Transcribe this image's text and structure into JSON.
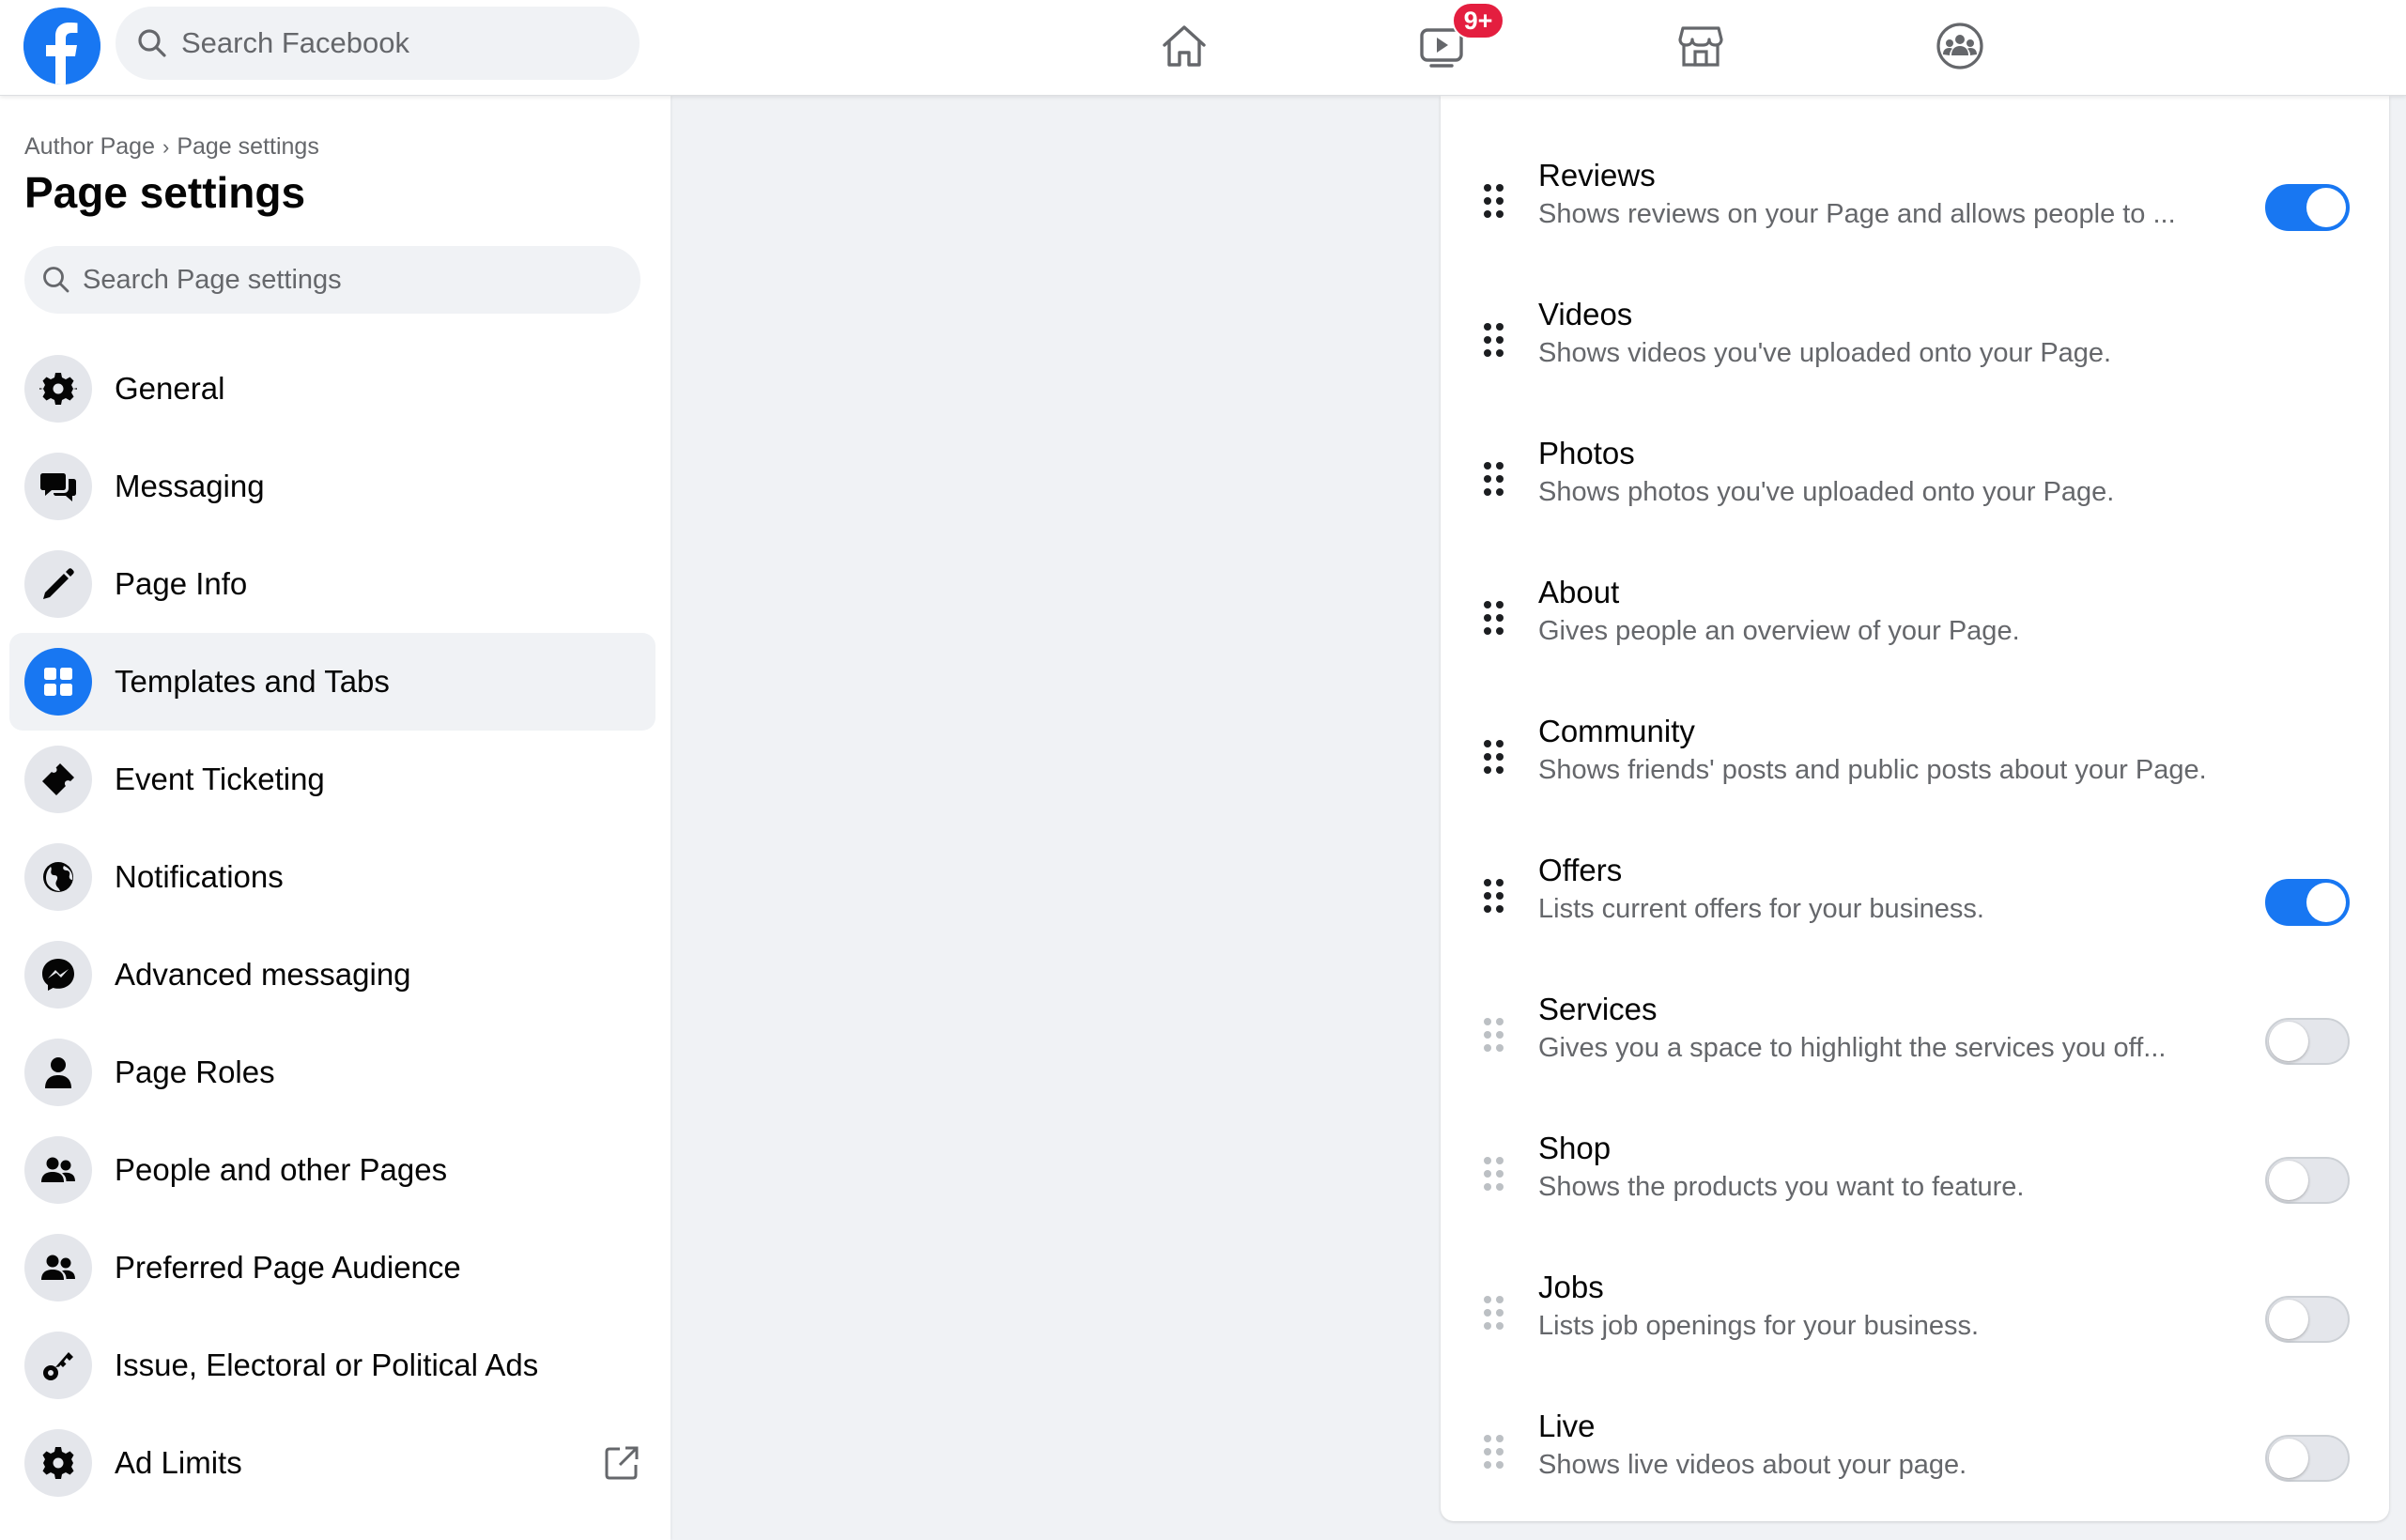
{
  "header": {
    "search_placeholder": "Search Facebook",
    "watch_badge": "9+",
    "brand_color": "#1877f2",
    "nav_icons": [
      "home-icon",
      "watch-icon",
      "marketplace-icon",
      "groups-icon"
    ]
  },
  "sidebar": {
    "breadcrumb": [
      "Author Page",
      "Page settings"
    ],
    "title": "Page settings",
    "search_placeholder": "Search Page settings",
    "items": [
      {
        "label": "General",
        "icon": "gear-icon",
        "active": false
      },
      {
        "label": "Messaging",
        "icon": "chat-bubbles-icon",
        "active": false
      },
      {
        "label": "Page Info",
        "icon": "pencil-icon",
        "active": false
      },
      {
        "label": "Templates and Tabs",
        "icon": "grid-icon",
        "active": true
      },
      {
        "label": "Event Ticketing",
        "icon": "ticket-icon",
        "active": false
      },
      {
        "label": "Notifications",
        "icon": "globe-icon",
        "active": false
      },
      {
        "label": "Advanced messaging",
        "icon": "messenger-icon",
        "active": false
      },
      {
        "label": "Page Roles",
        "icon": "person-icon",
        "active": false
      },
      {
        "label": "People and other Pages",
        "icon": "people-icon",
        "active": false
      },
      {
        "label": "Preferred Page Audience",
        "icon": "people-icon",
        "active": false
      },
      {
        "label": "Issue, Electoral or Political Ads",
        "icon": "key-icon",
        "active": false
      },
      {
        "label": "Ad Limits",
        "icon": "gear-icon",
        "active": false,
        "external": true
      }
    ]
  },
  "tabs": [
    {
      "title": "Reviews",
      "description": "Shows reviews on your Page and allows people to ...",
      "toggle": true,
      "draggable": true
    },
    {
      "title": "Videos",
      "description": "Shows videos you've uploaded onto your Page.",
      "toggle": null,
      "draggable": true
    },
    {
      "title": "Photos",
      "description": "Shows photos you've uploaded onto your Page.",
      "toggle": null,
      "draggable": true
    },
    {
      "title": "About",
      "description": "Gives people an overview of your Page.",
      "toggle": null,
      "draggable": true
    },
    {
      "title": "Community",
      "description": "Shows friends' posts and public posts about your Page.",
      "toggle": null,
      "draggable": true
    },
    {
      "title": "Offers",
      "description": "Lists current offers for your business.",
      "toggle": true,
      "draggable": true
    },
    {
      "title": "Services",
      "description": "Gives you a space to highlight the services you off...",
      "toggle": false,
      "draggable": false
    },
    {
      "title": "Shop",
      "description": "Shows the products you want to feature.",
      "toggle": false,
      "draggable": false
    },
    {
      "title": "Jobs",
      "description": "Lists job openings for your business.",
      "toggle": false,
      "draggable": false
    },
    {
      "title": "Live",
      "description": "Shows live videos about your page.",
      "toggle": false,
      "draggable": false
    }
  ]
}
